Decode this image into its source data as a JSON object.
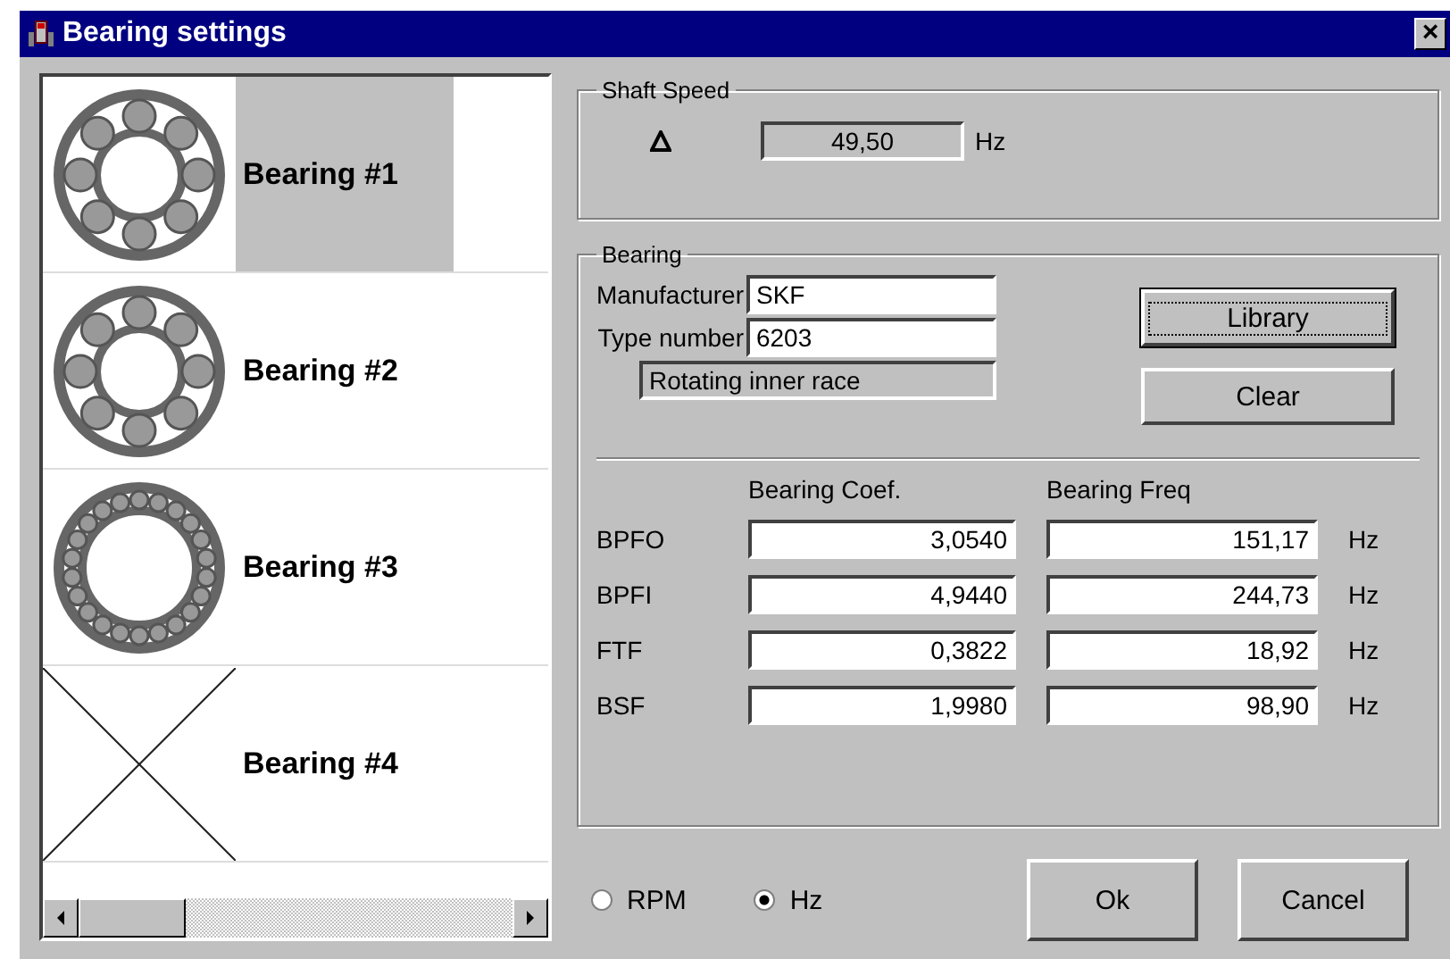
{
  "window": {
    "title": "Bearing settings",
    "close": "×"
  },
  "bearings": [
    {
      "label": "Bearing #1",
      "kind": "large-balls",
      "selected": true
    },
    {
      "label": "Bearing #2",
      "kind": "large-balls",
      "selected": false
    },
    {
      "label": "Bearing #3",
      "kind": "small-balls",
      "selected": false
    },
    {
      "label": "Bearing #4",
      "kind": "empty",
      "selected": false
    }
  ],
  "shaft_speed": {
    "title": "Shaft Speed",
    "value": "49,50",
    "unit": "Hz"
  },
  "bearing": {
    "title": "Bearing",
    "manufacturer_label": "Manufacturer",
    "manufacturer": "SKF",
    "type_label": "Type number",
    "type": "6203",
    "race": "Rotating inner race",
    "buttons": [
      {
        "label": "Library",
        "focused": true
      },
      {
        "label": "Clear",
        "focused": false
      }
    ],
    "coef_header": "Bearing Coef.",
    "freq_header": "Bearing Freq",
    "rows": [
      {
        "name": "BPFO",
        "coef": "3,0540",
        "freq": "151,17",
        "unit": "Hz"
      },
      {
        "name": "BPFI",
        "coef": "4,9440",
        "freq": "244,73",
        "unit": "Hz"
      },
      {
        "name": "FTF",
        "coef": "0,3822",
        "freq": "18,92",
        "unit": "Hz"
      },
      {
        "name": "BSF",
        "coef": "1,9980",
        "freq": "98,90",
        "unit": "Hz"
      }
    ]
  },
  "units": [
    {
      "label": "RPM",
      "selected": false
    },
    {
      "label": "Hz",
      "selected": true
    }
  ],
  "buttons": [
    {
      "label": "Ok"
    },
    {
      "label": "Cancel"
    }
  ]
}
